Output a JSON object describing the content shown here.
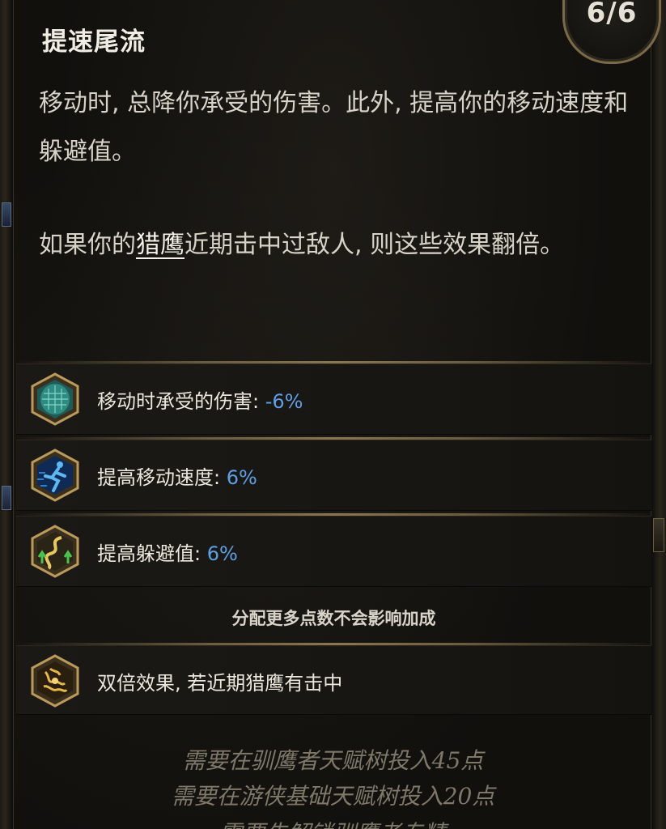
{
  "skill": {
    "title": "提速尾流",
    "points": "6/6"
  },
  "description": {
    "line1": "移动时, 总降你承受的伤害。此外, 提高你的移动速度和躲避值。",
    "line2_before": "如果你的",
    "line2_keyword": "猎鹰",
    "line2_after": "近期击中过敌人, 则这些效果翻倍。"
  },
  "stats": [
    {
      "label": "移动时承受的伤害: ",
      "value": "-6%",
      "icon": "shield-scales-icon"
    },
    {
      "label": "提高移动速度: ",
      "value": "6%",
      "icon": "running-figure-icon"
    },
    {
      "label": "提高躲避值: ",
      "value": "6%",
      "icon": "evasion-arrows-icon"
    }
  ],
  "note": "分配更多点数不会影响加成",
  "bonus": {
    "label": "双倍效果, 若近期猎鹰有击中",
    "icon": "falcon-crest-icon"
  },
  "requirements": [
    "需要在驯鹰者天赋树投入45点",
    "需要在游侠基础天赋树投入20点",
    "需要先解锁驯鹰者专精"
  ],
  "colors": {
    "stat_value": "#5e9fe6",
    "text": "#d8d3c8",
    "frame_gold": "#8a7650",
    "requirement_text": "#7d7869"
  }
}
